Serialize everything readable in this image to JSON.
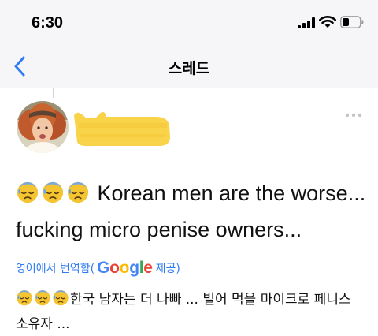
{
  "status_bar": {
    "time": "6:30",
    "icons": [
      "cellular-signal-icon",
      "wifi-icon",
      "battery-icon"
    ]
  },
  "nav": {
    "back_icon": "chevron-left-icon",
    "title": "스레드"
  },
  "post": {
    "emoji": "😓😓😓",
    "text": "Korean men are the worse... fucking micro penise owners...",
    "more_icon": "ellipsis-icon"
  },
  "translation": {
    "prefix": "영어에서 번역함(",
    "brand": "Google",
    "suffix": " 제공)",
    "emoji": "😓😓😓",
    "text": "한국 남자는 더 나빠 ... 빌어 먹을 마이크로 페니스 소유자 ..."
  },
  "colors": {
    "link_blue": "#2f7cf5",
    "redaction_yellow": "#f9d44a",
    "bar_background": "#f6f6f8"
  }
}
